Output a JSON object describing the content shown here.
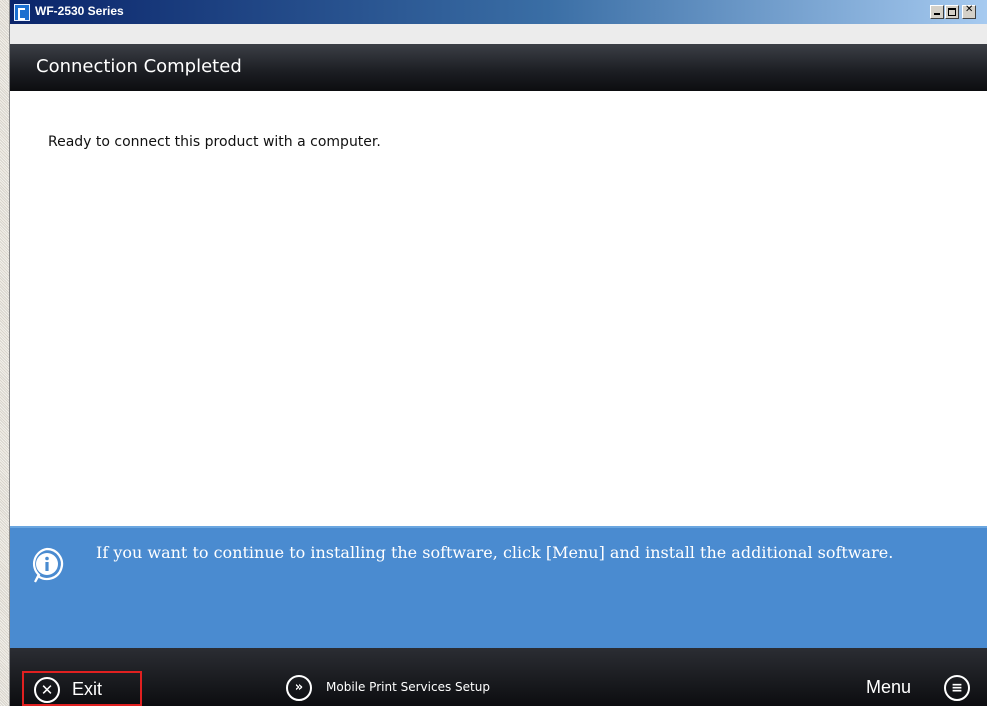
{
  "window": {
    "title": "WF-2530 Series"
  },
  "header": {
    "title": "Connection Completed"
  },
  "main": {
    "message": "Ready to connect this product with a computer."
  },
  "info_bar": {
    "text": "If you want to continue to installing the software, click [Menu] and install the additional software.",
    "icon": "info-icon"
  },
  "footer": {
    "exit_label": "Exit",
    "exit_icon_glyph": "✕",
    "mobile_label": "Mobile Print Services Setup",
    "mobile_icon_glyph": "»",
    "menu_label": "Menu",
    "menu_icon_glyph": "≡"
  },
  "colors": {
    "info_bar": "#4a8bd0",
    "footer": "#0c0d10",
    "highlight": "#e02020"
  }
}
